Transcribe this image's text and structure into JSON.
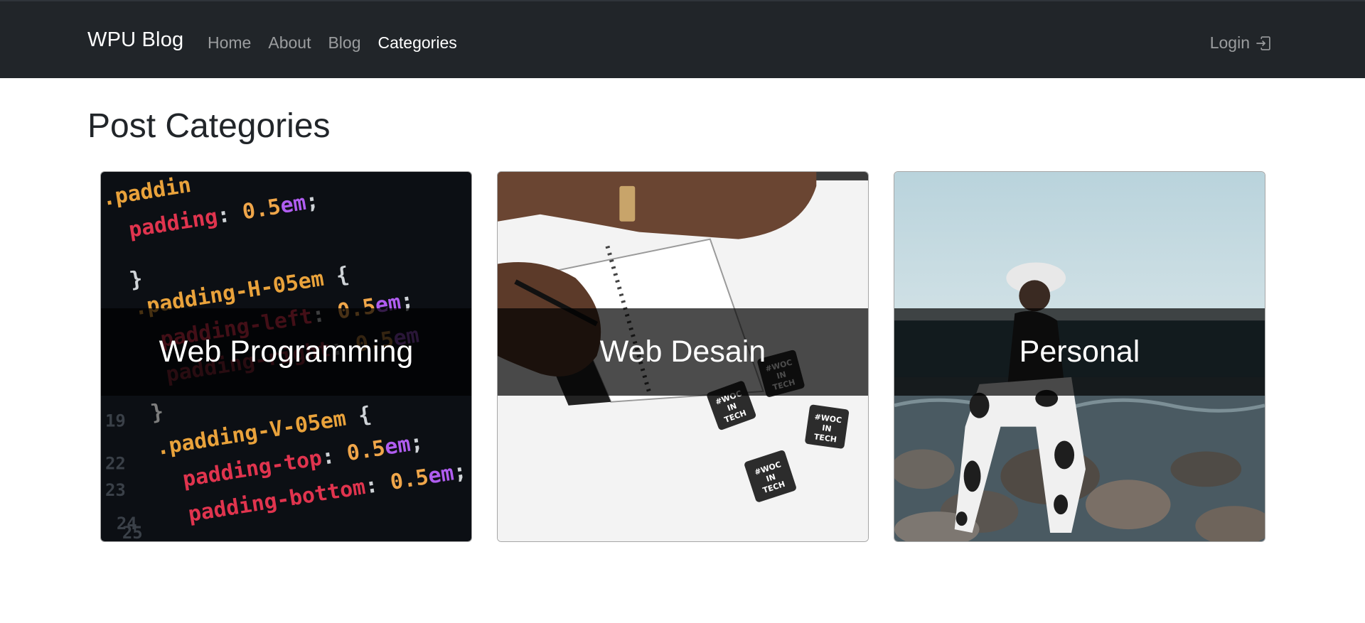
{
  "navbar": {
    "brand": "WPU Blog",
    "links": [
      {
        "label": "Home",
        "active": false
      },
      {
        "label": "About",
        "active": false
      },
      {
        "label": "Blog",
        "active": false
      },
      {
        "label": "Categories",
        "active": true
      }
    ],
    "login_label": "Login",
    "login_icon": "box-arrow-in-right-icon"
  },
  "page": {
    "title": "Post Categories"
  },
  "categories": [
    {
      "name": "Web Programming",
      "image": "css-code-closeup"
    },
    {
      "name": "Web Desain",
      "image": "notebook-desk-woc-in-tech-stickers"
    },
    {
      "name": "Personal",
      "image": "woman-on-rocky-beach"
    }
  ],
  "colors": {
    "navbar_bg": "#212529",
    "active_link": "#ffffff",
    "inactive_link": "rgba(255,255,255,0.55)",
    "overlay": "rgba(0,0,0,0.7)"
  }
}
